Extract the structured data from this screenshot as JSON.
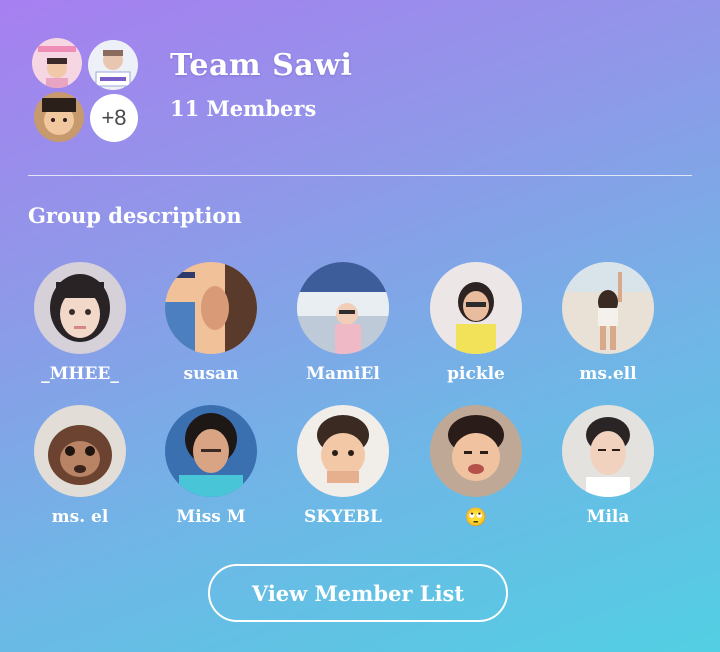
{
  "group": {
    "name": "Team Sawi",
    "member_count": "11 Members",
    "more_members_badge": "+8"
  },
  "section": {
    "title": "Group description"
  },
  "members": [
    {
      "name": "_MHEE_"
    },
    {
      "name": "susan"
    },
    {
      "name": "MamiEl"
    },
    {
      "name": "pickle"
    },
    {
      "name": "ms.ell"
    },
    {
      "name": "ms. el"
    },
    {
      "name": "Miss M"
    },
    {
      "name": "SKYEBL"
    },
    {
      "name": "🙄"
    },
    {
      "name": "Mila"
    }
  ],
  "actions": {
    "view_member_list": "View Member List"
  },
  "colors": {
    "gradient_start": "#a77ff0",
    "gradient_end": "#52cfe3",
    "text": "#ffffff"
  }
}
